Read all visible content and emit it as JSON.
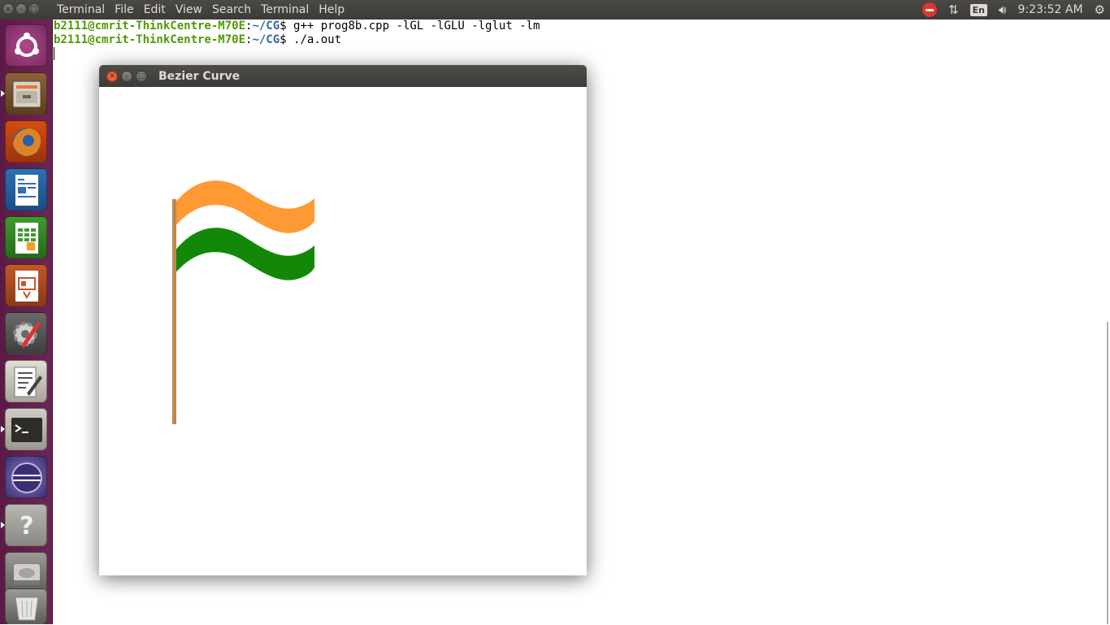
{
  "top_panel": {
    "app_name": "Terminal",
    "menus": [
      "File",
      "Edit",
      "View",
      "Search",
      "Terminal",
      "Help"
    ],
    "language": "En",
    "clock": "9:23:52 AM"
  },
  "launcher": {
    "items": [
      "ubuntu-dash",
      "files",
      "firefox",
      "libreoffice-writer",
      "libreoffice-calc",
      "libreoffice-impress",
      "system-settings",
      "text-editor",
      "terminal",
      "eclipse",
      "help",
      "disk-drive",
      "trash"
    ]
  },
  "terminal": {
    "lines": [
      {
        "user": "b2111@cmrit-ThinkCentre-M70E",
        "path": "~/CG",
        "command": "g++ prog8b.cpp -lGL -lGLU -lglut -lm"
      },
      {
        "user": "b2111@cmrit-ThinkCentre-M70E",
        "path": "~/CG",
        "command": "./a.out"
      }
    ]
  },
  "bezier_window": {
    "title": "Bezier Curve",
    "colors": {
      "top_band": "#ff9933",
      "bottom_band": "#138808",
      "pole": "#c08751"
    }
  }
}
